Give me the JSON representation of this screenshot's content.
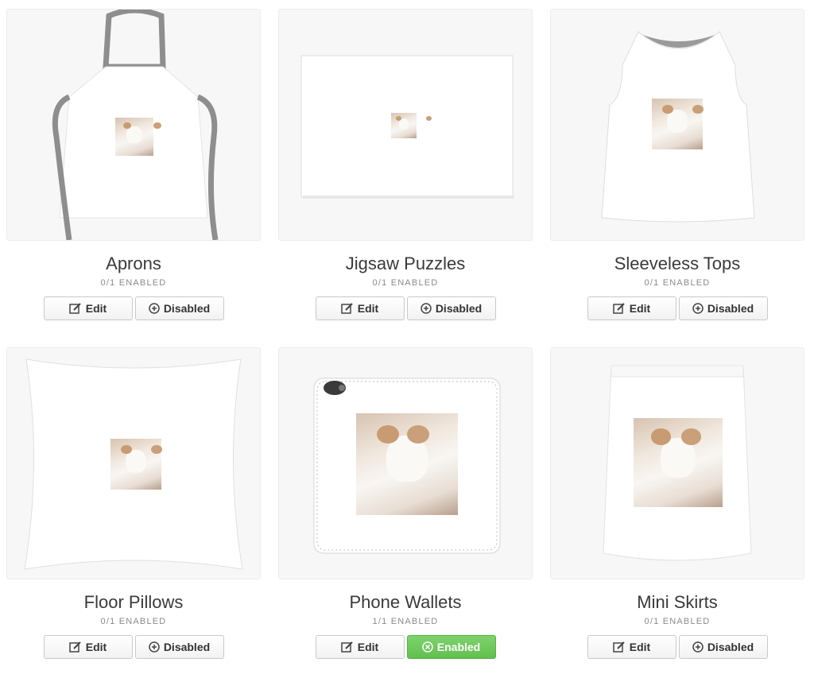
{
  "products": [
    {
      "title": "Aprons",
      "status": "0/1 ENABLED",
      "edit_label": "Edit",
      "toggle_label": "Disabled",
      "enabled": false,
      "icon": "apron-icon"
    },
    {
      "title": "Jigsaw Puzzles",
      "status": "0/1 ENABLED",
      "edit_label": "Edit",
      "toggle_label": "Disabled",
      "enabled": false,
      "icon": "puzzle-icon"
    },
    {
      "title": "Sleeveless Tops",
      "status": "0/1 ENABLED",
      "edit_label": "Edit",
      "toggle_label": "Disabled",
      "enabled": false,
      "icon": "tank-top-icon"
    },
    {
      "title": "Floor Pillows",
      "status": "0/1 ENABLED",
      "edit_label": "Edit",
      "toggle_label": "Disabled",
      "enabled": false,
      "icon": "pillow-icon"
    },
    {
      "title": "Phone Wallets",
      "status": "1/1 ENABLED",
      "edit_label": "Edit",
      "toggle_label": "Enabled",
      "enabled": true,
      "icon": "phone-wallet-icon"
    },
    {
      "title": "Mini Skirts",
      "status": "0/1 ENABLED",
      "edit_label": "Edit",
      "toggle_label": "Disabled",
      "enabled": false,
      "icon": "skirt-icon"
    }
  ],
  "colors": {
    "enabled_green": "#6cc75a",
    "text_dark": "#3a3a3a",
    "text_muted": "#8a8a8a"
  }
}
